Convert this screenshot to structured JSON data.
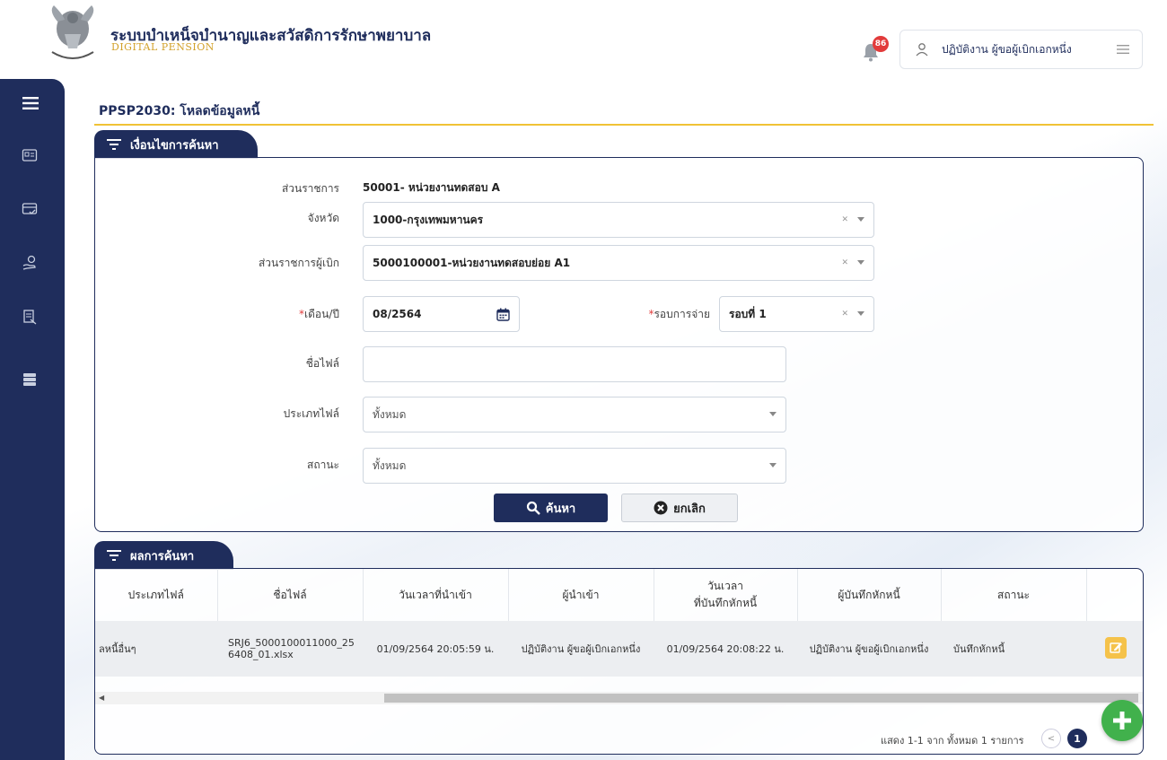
{
  "header": {
    "app_title": "ระบบบำเหน็จบำนาญและสวัสดิการรักษาพยาบาล",
    "app_subtitle": "DIGITAL PENSION",
    "notification_count": "86",
    "user_name": "ปฏิบัติงาน ผู้ขอผู้เบิกเอกหนึ่ง"
  },
  "sidebar": {
    "items": [
      "menu-icon",
      "id-card-icon",
      "check-card-icon",
      "hand-coin-icon",
      "document-icon",
      "server-icon"
    ]
  },
  "page": {
    "title": "PPSP2030: โหลดข้อมูลหนี้"
  },
  "search": {
    "tab_label": "เงื่อนไขการค้นหา",
    "agency_label": "ส่วนราชการ",
    "agency_value": "50001- หน่วยงานทดสอบ A",
    "province_label": "จังหวัด",
    "province_value": "1000-กรุงเทพมหานคร",
    "sub_agency_label": "ส่วนราชการผู้เบิก",
    "sub_agency_value": "5000100001-หน่วยงานทดสอบย่อย A1",
    "month_label": "เดือน/ปี",
    "month_value": "08/2564",
    "round_label": "รอบการจ่าย",
    "round_value": "รอบที่ 1",
    "filename_label": "ชื่อไฟล์",
    "filename_value": "",
    "filetype_label": "ประเภทไฟล์",
    "filetype_value": "ทั้งหมด",
    "status_label": "สถานะ",
    "status_value": "ทั้งหมด",
    "search_button": "ค้นหา",
    "cancel_button": "ยกเลิก"
  },
  "results": {
    "tab_label": "ผลการค้นหา",
    "columns": [
      "ประเภทไฟล์",
      "ชื่อไฟล์",
      "วันเวลาที่นำเข้า",
      "ผู้นำเข้า",
      "วันเวลา\nที่บันทึกหักหนี้",
      "ผู้บันทึกหักหนี้",
      "สถานะ",
      ""
    ],
    "rows": [
      {
        "type": "ลหนี้อื่นๆ",
        "filename": "SRJ6_5000100011000_256408_01.xlsx",
        "import_time": "01/09/2564 20:05:59 น.",
        "importer": "ปฏิบัติงาน ผู้ขอผู้เบิกเอกหนึ่ง",
        "deduct_time": "01/09/2564 20:08:22 น.",
        "deductor": "ปฏิบัติงาน ผู้ขอผู้เบิกเอกหนึ่ง",
        "status": "บันทึกหักหนี้"
      }
    ],
    "pager_text": "แสดง 1-1 จาก ทั้งหมด 1 รายการ",
    "current_page": "1"
  },
  "colors": {
    "primary": "#1f2d5c",
    "accent_line": "#f0c235",
    "fab": "#41b14c",
    "badge": "#e23b3b"
  }
}
